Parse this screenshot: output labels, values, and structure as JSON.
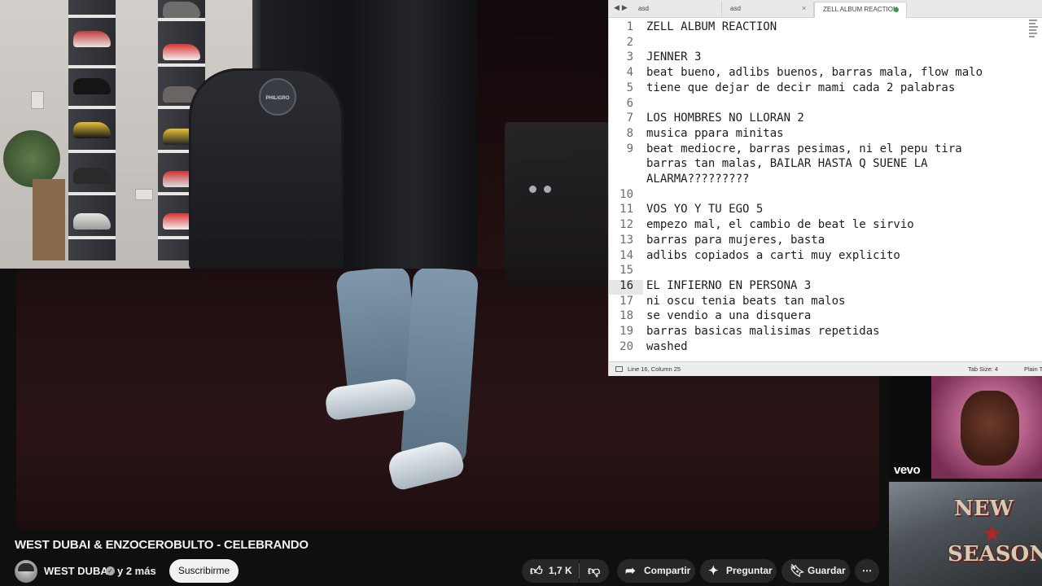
{
  "editor": {
    "tabs": [
      {
        "label": "asd"
      },
      {
        "label": "asd"
      },
      {
        "label": "ZELL ALBUM REACTION"
      }
    ],
    "lines": [
      {
        "n": "1",
        "text": "ZELL ALBUM REACTION"
      },
      {
        "n": "2",
        "text": ""
      },
      {
        "n": "3",
        "text": "JENNER 3"
      },
      {
        "n": "4",
        "text": "beat bueno, adlibs buenos, barras mala, flow malo"
      },
      {
        "n": "5",
        "text": "tiene que dejar de decir mami cada 2 palabras"
      },
      {
        "n": "6",
        "text": ""
      },
      {
        "n": "7",
        "text": "LOS HOMBRES NO LLORAN 2"
      },
      {
        "n": "8",
        "text": "musica ppara minitas"
      },
      {
        "n": "9",
        "text": "beat mediocre, barras pesimas, ni el pepu tira"
      },
      {
        "n": "",
        "text": "barras tan malas, BAILAR HASTA Q SUENE LA"
      },
      {
        "n": "",
        "text": "ALARMA?????????"
      },
      {
        "n": "10",
        "text": ""
      },
      {
        "n": "11",
        "text": "VOS YO Y TU EGO 5"
      },
      {
        "n": "12",
        "text": "empezo mal, el cambio de beat le sirvio"
      },
      {
        "n": "13",
        "text": "barras para mujeres, basta"
      },
      {
        "n": "14",
        "text": "adlibs copiados a carti muy explicito"
      },
      {
        "n": "15",
        "text": ""
      },
      {
        "n": "16",
        "text": "EL INFIERNO EN PERSONA 3"
      },
      {
        "n": "17",
        "text": "ni oscu tenia beats tan malos"
      },
      {
        "n": "18",
        "text": "se vendio a una disquera"
      },
      {
        "n": "19",
        "text": "barras basicas malisimas repetidas"
      },
      {
        "n": "20",
        "text": "washed"
      }
    ],
    "status": {
      "position": "Line 16, Column 25",
      "tab_size": "Tab Size: 4",
      "syntax": "Plain Te"
    }
  },
  "webcam": {
    "chair_logo": "PHILIGRO"
  },
  "video": {
    "title": "WEST DUBAI & ENZOCEROBULTO - CELEBRANDO",
    "channel": "WEST DUBAI",
    "more_channels": "y 2 más",
    "subscribe_label": "Suscribirme",
    "like_count": "1,7 K",
    "share_label": "Compartir",
    "ask_label": "Preguntar",
    "save_label": "Guardar"
  },
  "sidebar": {
    "thumb1_badge": "vevo",
    "thumb2_line1": "NEW",
    "thumb2_line2": "SEASON"
  },
  "colors": {
    "background": "#0f0f0f",
    "pill": "#272727",
    "subscribe_bg": "#f1f1f1",
    "modified_dot": "#3a9a4a"
  }
}
